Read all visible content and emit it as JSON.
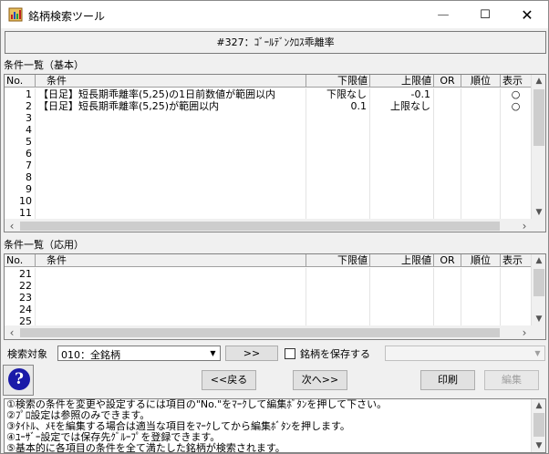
{
  "window": {
    "title": "銘柄検索ツール",
    "minimize_glyph": "—",
    "maximize_glyph": "☐",
    "close_glyph": "✕"
  },
  "screen_title": "#327：ｺﾞｰﾙﾃﾞﾝｸﾛｽ乖離率",
  "basic": {
    "label": "条件一覧（基本）",
    "columns": [
      "No.",
      "条件",
      "下限値",
      "上限値",
      "OR",
      "順位",
      "表示"
    ],
    "rows": [
      {
        "no": "1",
        "cond": "【日足】短長期乖離率(5,25)の1日前数値が範囲以内",
        "low": "下限なし",
        "high": "-0.1",
        "or": "",
        "rank": "",
        "show": "○"
      },
      {
        "no": "2",
        "cond": "【日足】短長期乖離率(5,25)が範囲以内",
        "low": "0.1",
        "high": "上限なし",
        "or": "",
        "rank": "",
        "show": "○"
      },
      {
        "no": "3",
        "cond": "",
        "low": "",
        "high": "",
        "or": "",
        "rank": "",
        "show": ""
      },
      {
        "no": "4",
        "cond": "",
        "low": "",
        "high": "",
        "or": "",
        "rank": "",
        "show": ""
      },
      {
        "no": "5",
        "cond": "",
        "low": "",
        "high": "",
        "or": "",
        "rank": "",
        "show": ""
      },
      {
        "no": "6",
        "cond": "",
        "low": "",
        "high": "",
        "or": "",
        "rank": "",
        "show": ""
      },
      {
        "no": "7",
        "cond": "",
        "low": "",
        "high": "",
        "or": "",
        "rank": "",
        "show": ""
      },
      {
        "no": "8",
        "cond": "",
        "low": "",
        "high": "",
        "or": "",
        "rank": "",
        "show": ""
      },
      {
        "no": "9",
        "cond": "",
        "low": "",
        "high": "",
        "or": "",
        "rank": "",
        "show": ""
      },
      {
        "no": "10",
        "cond": "",
        "low": "",
        "high": "",
        "or": "",
        "rank": "",
        "show": ""
      },
      {
        "no": "11",
        "cond": "",
        "low": "",
        "high": "",
        "or": "",
        "rank": "",
        "show": ""
      }
    ]
  },
  "applied": {
    "label": "条件一覧（応用）",
    "columns": [
      "No.",
      "条件",
      "下限値",
      "上限値",
      "OR",
      "順位",
      "表示"
    ],
    "rows": [
      {
        "no": "21"
      },
      {
        "no": "22"
      },
      {
        "no": "23"
      },
      {
        "no": "24"
      },
      {
        "no": "25"
      }
    ]
  },
  "search_bar": {
    "target_label": "検索対象",
    "target_value": "010：全銘柄",
    "forward_label": ">>",
    "save_checkbox_label": "銘柄を保存する",
    "save_checked": false,
    "group_value": ""
  },
  "buttons": {
    "help": "?",
    "back": "<<戻る",
    "next": "次へ>>",
    "print": "印刷",
    "edit": "編集"
  },
  "notes": [
    "①検索の条件を変更や設定するには項目の\"No.\"をﾏｰｸして編集ﾎﾞﾀﾝを押して下さい。",
    "②ﾌﾟﾛ設定は参照のみできます。",
    "③ﾀｲﾄﾙ、ﾒﾓを編集する場合は適当な項目をﾏｰｸしてから編集ﾎﾞﾀﾝを押します。",
    "④ﾕｰｻﾞｰ設定では保存先ｸﾞﾙｰﾌﾟを登録できます。",
    "⑤基本的に各項目の条件を全て満たした銘柄が検索されます。"
  ],
  "colors": {
    "help_circle": "#1a1aa8",
    "grid_bg": "#ffffff",
    "window_bg": "#f0f0f0"
  }
}
